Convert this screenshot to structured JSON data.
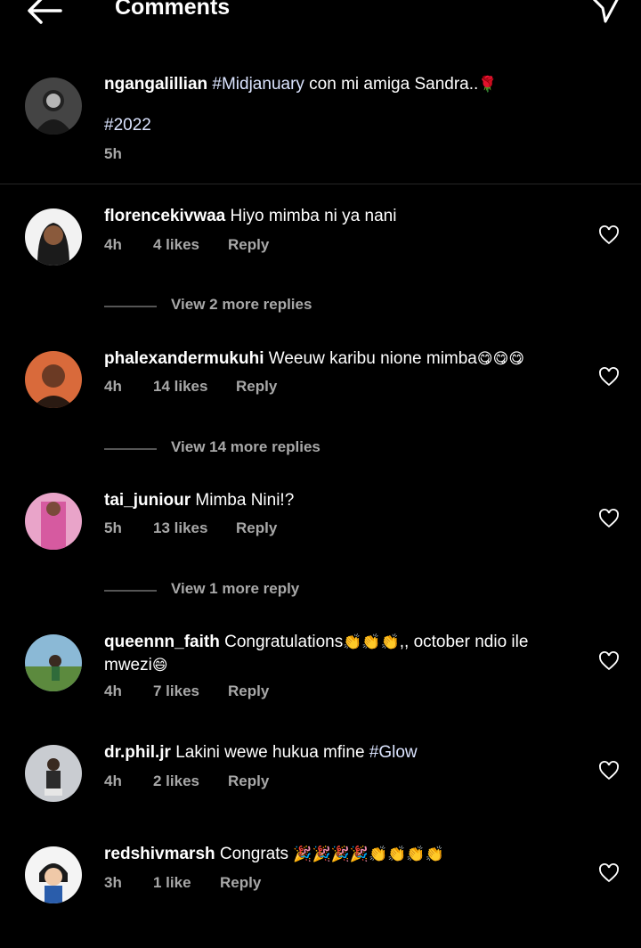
{
  "header": {
    "title": "Comments"
  },
  "caption": {
    "username": "ngangalillian",
    "hashtag1": "#Midjanuary",
    "text": " con mi amiga Sandra..",
    "emoji": "🌹",
    "hashtag2": "#2022",
    "time": "5h"
  },
  "comments": [
    {
      "username": "florencekivwaa",
      "text": " Hiyo mimba ni ya nani",
      "time": "4h",
      "likes": "4 likes",
      "reply": "Reply",
      "view_replies": "View 2 more replies"
    },
    {
      "username": "phalexandermukuhi",
      "text": " Weeuw karibu nione mimba",
      "emoji": "😋😋😋",
      "time": "4h",
      "likes": "14 likes",
      "reply": "Reply",
      "view_replies": "View 14 more replies"
    },
    {
      "username": "tai_juniour",
      "text": " Mimba Nini!?",
      "time": "5h",
      "likes": "13 likes",
      "reply": "Reply",
      "view_replies": "View 1 more reply"
    },
    {
      "username": "queennn_faith",
      "text": " Congratulations",
      "emoji1": "👏👏👏",
      "text2": ",, october ndio ile mwezi",
      "emoji2": "😄",
      "time": "4h",
      "likes": "7 likes",
      "reply": "Reply"
    },
    {
      "username": "dr.phil.jr",
      "text": " Lakini wewe hukua mfine ",
      "hashtag": "#Glow",
      "time": "4h",
      "likes": "2 likes",
      "reply": "Reply"
    },
    {
      "username": "redshivmarsh",
      "text": " Congrats ",
      "emoji": "🎉🎉🎉🎉👏👏👏👏",
      "time": "3h",
      "likes": "1 like",
      "reply": "Reply"
    }
  ]
}
